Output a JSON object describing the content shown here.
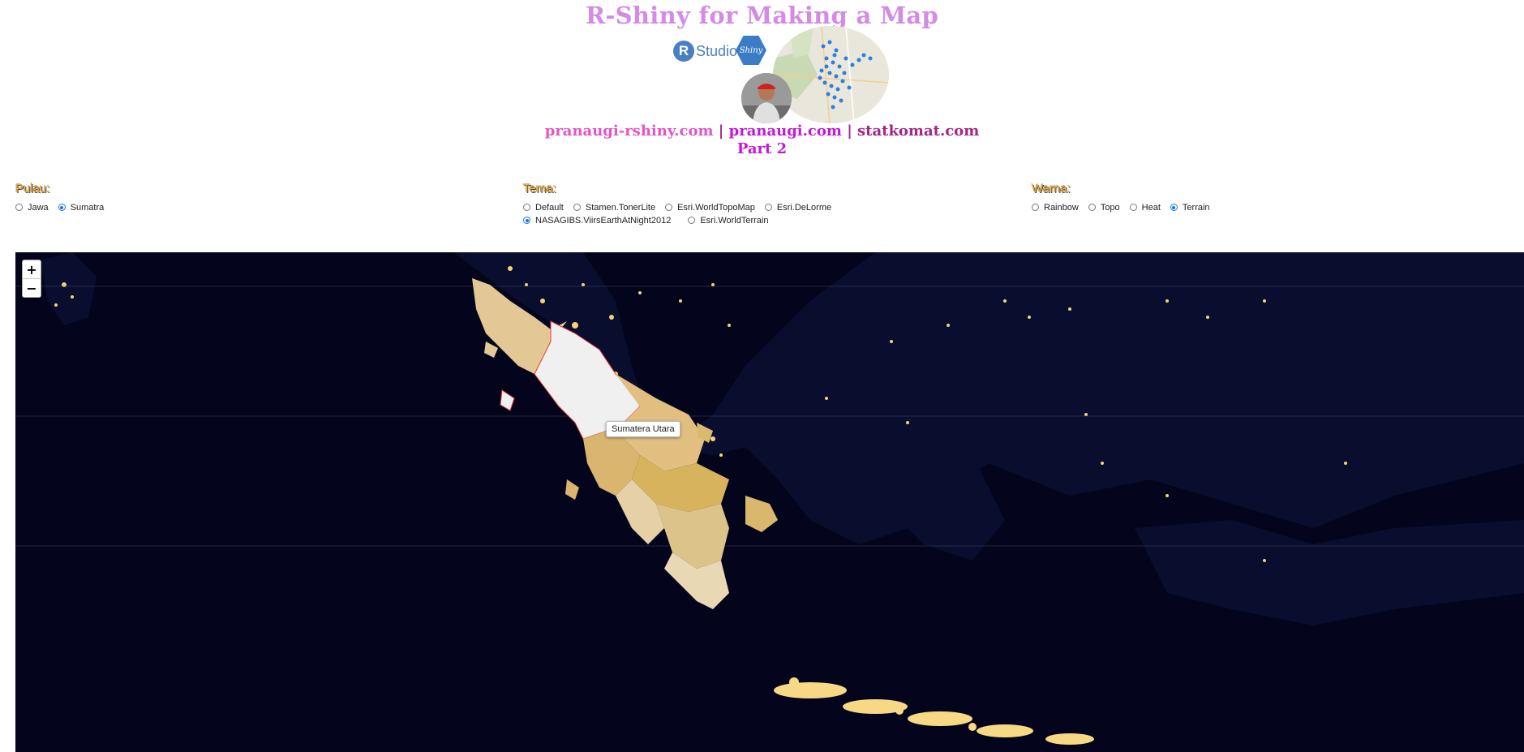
{
  "header": {
    "title": "R-Shiny for Making a Map",
    "logo_r": "R",
    "logo_studio": "Studio",
    "logo_shiny": "Shiny",
    "link1": "pranaugi-rshiny.com",
    "link2": "pranaugi.com",
    "link3": "statkomat.com",
    "separator": "|",
    "part": "Part 2"
  },
  "controls": {
    "pulau": {
      "label": "Pulau:",
      "options": [
        "Jawa",
        "Sumatra"
      ],
      "selected": "Sumatra"
    },
    "tema": {
      "label": "Tema:",
      "options": [
        "Default",
        "Stamen.TonerLite",
        "Esri.WorldTopoMap",
        "Esri.DeLorme",
        "NASAGIBS.ViirsEarthAtNight2012",
        "Esri.WorldTerrain"
      ],
      "selected": "NASAGIBS.ViirsEarthAtNight2012"
    },
    "warna": {
      "label": "Warna:",
      "options": [
        "Rainbow",
        "Topo",
        "Heat",
        "Terrain"
      ],
      "selected": "Terrain"
    }
  },
  "map": {
    "zoom_in": "+",
    "zoom_out": "−",
    "tooltip": "Sumatera Utara",
    "colors": {
      "sea": "#04051c",
      "aceh": "#e3c896",
      "sumut_highlight": "#f0f0f0",
      "riau": "#e0bf80",
      "sumbar": "#d9b570",
      "jambi": "#d6b35c",
      "sumsel": "#dcc38a",
      "bengkulu": "#e6d0a8",
      "lampung": "#e8d8b4",
      "kepri": "#d9b870",
      "babel": "#d8b86c",
      "highlight_border": "#e04040"
    }
  }
}
